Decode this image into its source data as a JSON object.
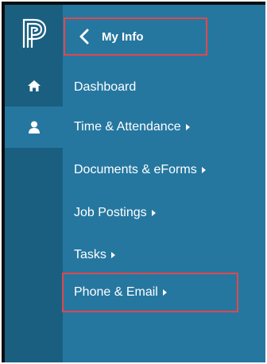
{
  "header": {
    "title": "My Info",
    "back_icon": "chevron-left-icon"
  },
  "rail": {
    "logo_icon": "powerschool-logo-icon",
    "home_icon": "home-icon",
    "user_icon": "user-icon"
  },
  "menu": {
    "items": [
      {
        "label": "Dashboard",
        "has_submenu": false
      },
      {
        "label": "Time & Attendance",
        "has_submenu": true
      },
      {
        "label": "Documents & eForms",
        "has_submenu": true
      },
      {
        "label": "Job Postings",
        "has_submenu": true
      },
      {
        "label": "Tasks",
        "has_submenu": true
      },
      {
        "label": "Phone & Email",
        "has_submenu": true
      }
    ]
  },
  "colors": {
    "rail": "#1a5f80",
    "panel": "#2577a0",
    "highlight": "#e0484c",
    "text": "#ffffff"
  }
}
